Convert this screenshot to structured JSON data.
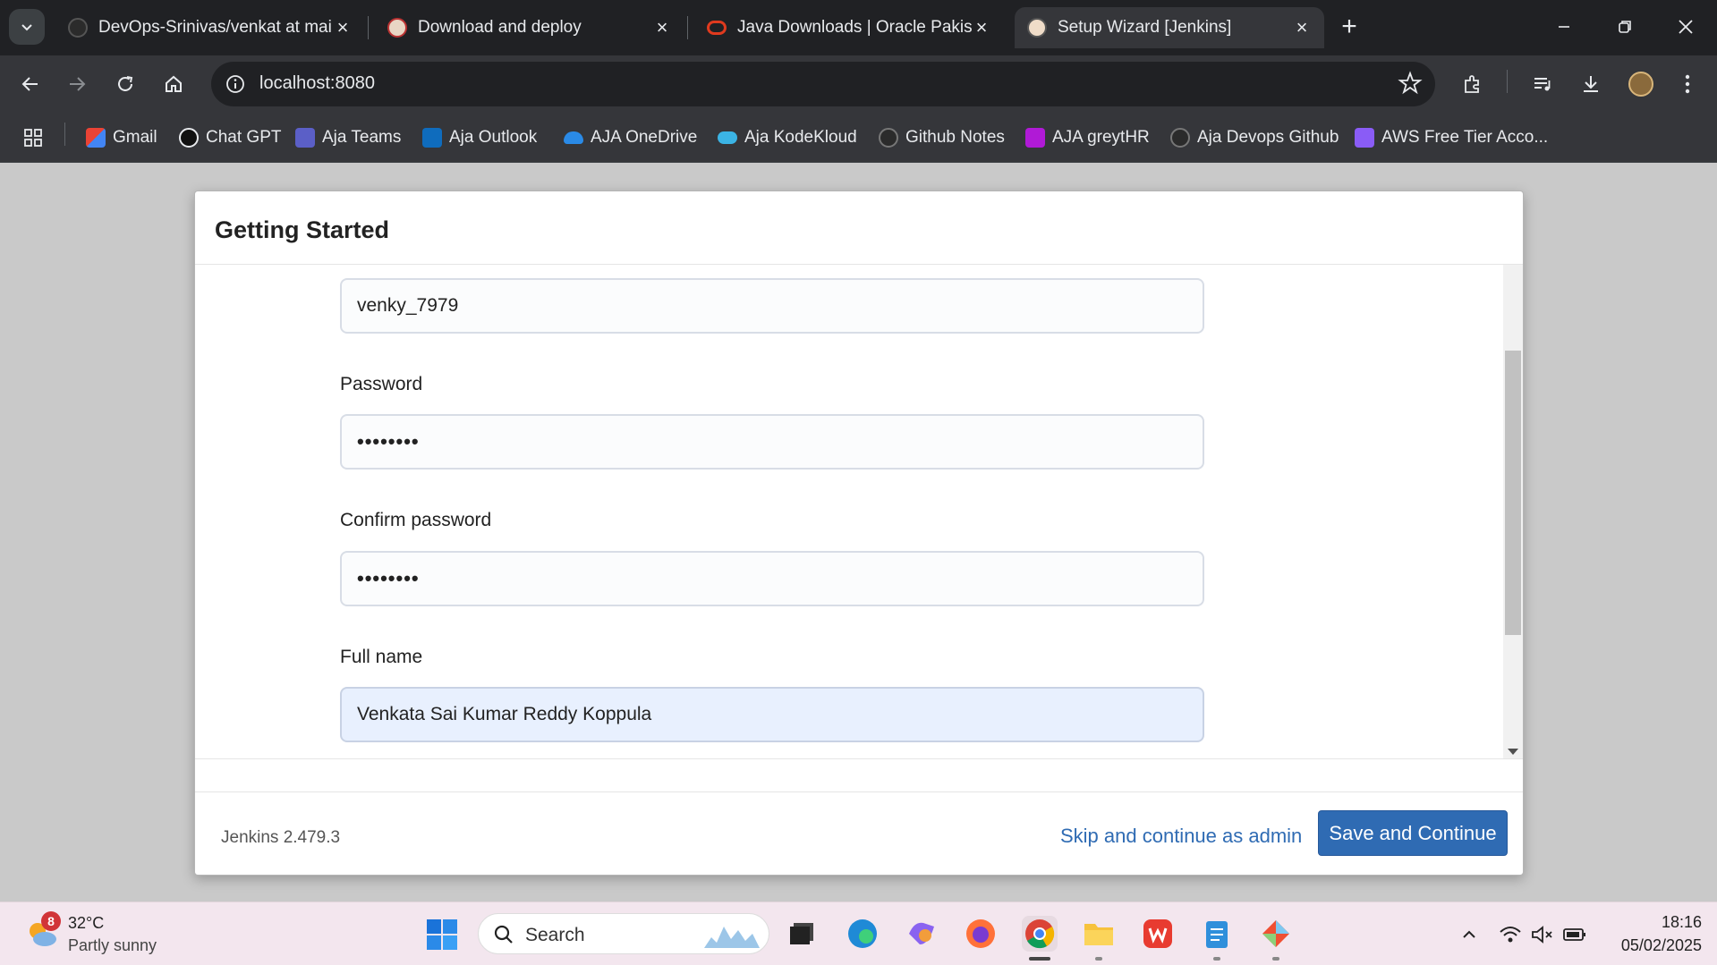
{
  "browser": {
    "tabs": [
      {
        "title": "DevOps-Srinivas/venkat at main",
        "active": false
      },
      {
        "title": "Download and deploy",
        "active": false
      },
      {
        "title": "Java Downloads | Oracle Pakistan",
        "active": false
      },
      {
        "title": "Setup Wizard [Jenkins]",
        "active": true
      }
    ],
    "url": "localhost:8080",
    "bookmarks": [
      {
        "label": "Gmail",
        "icon": "gmail-icon"
      },
      {
        "label": "Chat GPT",
        "icon": "chatgpt-icon"
      },
      {
        "label": "Aja Teams",
        "icon": "teams-icon"
      },
      {
        "label": "Aja Outlook",
        "icon": "outlook-icon"
      },
      {
        "label": "AJA OneDrive",
        "icon": "onedrive-icon"
      },
      {
        "label": "Aja KodeKloud",
        "icon": "kodekloud-icon"
      },
      {
        "label": "Github Notes",
        "icon": "github-icon"
      },
      {
        "label": "AJA greytHR",
        "icon": "greythr-icon"
      },
      {
        "label": "Aja Devops Github",
        "icon": "github-icon"
      },
      {
        "label": "AWS Free Tier Acco...",
        "icon": "aws-icon"
      }
    ]
  },
  "wizard": {
    "title": "Getting Started",
    "username_value": "venky_7979",
    "password_label": "Password",
    "password_value": "••••••••",
    "confirm_label": "Confirm password",
    "confirm_value": "••••••••",
    "fullname_label": "Full name",
    "fullname_value": "Venkata Sai Kumar Reddy Koppula",
    "version": "Jenkins 2.479.3",
    "skip_label": "Skip and continue as admin",
    "save_label": "Save and Continue"
  },
  "taskbar": {
    "weather_badge": "8",
    "weather_temp": "32°C",
    "weather_desc": "Partly sunny",
    "search_label": "Search",
    "time": "18:16",
    "date": "05/02/2025"
  },
  "colors": {
    "accent": "#2f6bb3",
    "chrome_dark": "#202124",
    "chrome_toolbar": "#35363a",
    "taskbar": "#f3e6ee"
  }
}
